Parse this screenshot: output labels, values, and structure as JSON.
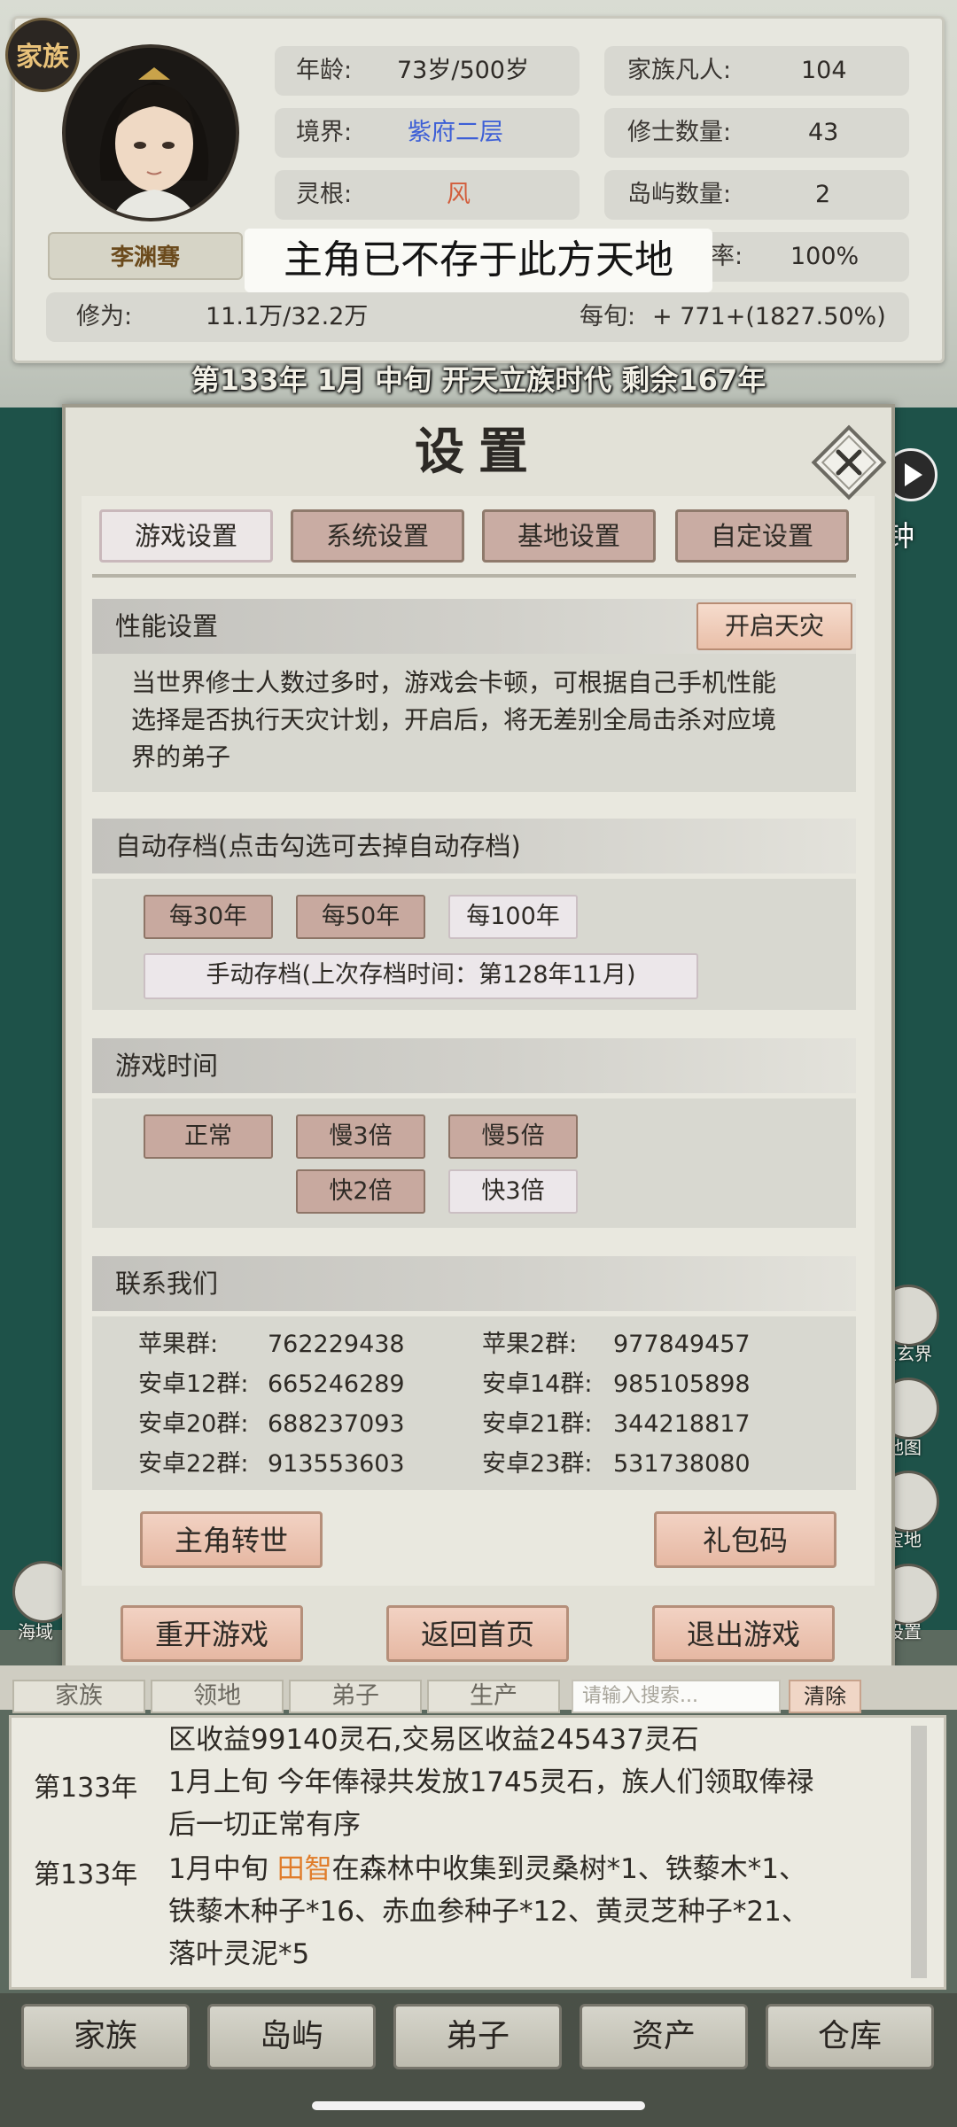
{
  "header": {
    "badge": "家族",
    "name": "李渊骞",
    "toast": "主角已不存于此方天地",
    "age_label": "年龄:",
    "age_value": "73岁/500岁",
    "family_label": "家族凡人:",
    "family_value": "104",
    "realm_label": "境界:",
    "realm_value": "紫府二层",
    "cultivator_label": "修士数量:",
    "cultivator_value": "43",
    "root_label": "灵根:",
    "root_value": "风",
    "island_label": "岛屿数量:",
    "island_value": "2",
    "rate_partial": "率:",
    "rate_value": "100%",
    "cult_label": "修为:",
    "cult_value": "11.1万/32.2万",
    "per_label": "每旬:",
    "per_value": "+ 771+(1827.50%)",
    "date_line": "第133年 1月 中旬  开天立族时代 剩余167年"
  },
  "side": {
    "play_partial": "钟",
    "right_labels": [
      "上玄界",
      "地图",
      "宝地",
      "设置"
    ],
    "left_label": "海域"
  },
  "dialog": {
    "title": "设置",
    "tabs": [
      "游戏设置",
      "系统设置",
      "基地设置",
      "自定设置"
    ],
    "perf_title": "性能设置",
    "perf_button": "开启天灾",
    "perf_desc_1": "当世界修士人数过多时，游戏会卡顿，可根据自己手机性能",
    "perf_desc_2": "选择是否执行天灾计划，开启后，将无差别全局击杀对应境",
    "perf_desc_3": "界的弟子",
    "autosave_title": "自动存档(点击勾选可去掉自动存档)",
    "autosave_options": [
      "每30年",
      "每50年",
      "每100年"
    ],
    "manual_save": "手动存档(上次存档时间：第128年11月)",
    "time_title": "游戏时间",
    "time_options": [
      "正常",
      "慢3倍",
      "慢5倍",
      "快2倍",
      "快3倍"
    ],
    "contact_title": "联系我们",
    "contacts": [
      {
        "label": "苹果群:",
        "value": "762229438"
      },
      {
        "label": "苹果2群:",
        "value": "977849457"
      },
      {
        "label": "安卓12群:",
        "value": "665246289"
      },
      {
        "label": "安卓14群:",
        "value": "985105898"
      },
      {
        "label": "安卓20群:",
        "value": "688237093"
      },
      {
        "label": "安卓21群:",
        "value": "344218817"
      },
      {
        "label": "安卓22群:",
        "value": "913553603"
      },
      {
        "label": "安卓23群:",
        "value": "531738080"
      }
    ],
    "reincarnate": "主角转世",
    "gift_code": "礼包码",
    "restart": "重开游戏",
    "home": "返回首页",
    "quit": "退出游戏"
  },
  "log_tabs": [
    "家族",
    "领地",
    "弟子",
    "生产"
  ],
  "search": {
    "placeholder": "请输入搜索...",
    "clear": "清除"
  },
  "log": {
    "line0": "区收益99140灵石,交易区收益245437灵石",
    "year1": "第133年",
    "line1a": "1月上旬 今年俸禄共发放1745灵石，族人们领取俸禄",
    "line1b": "后一切正常有序",
    "year2": "第133年",
    "line2a_pre": "1月中旬 ",
    "line2a_name": "田智",
    "line2a_post": "在森林中收集到灵桑树*1、铁藜木*1、",
    "line2b": "铁藜木种子*16、赤血参种子*12、黄灵芝种子*21、",
    "line2c": "落叶灵泥*5"
  },
  "nav": [
    "家族",
    "岛屿",
    "弟子",
    "资产",
    "仓库"
  ]
}
